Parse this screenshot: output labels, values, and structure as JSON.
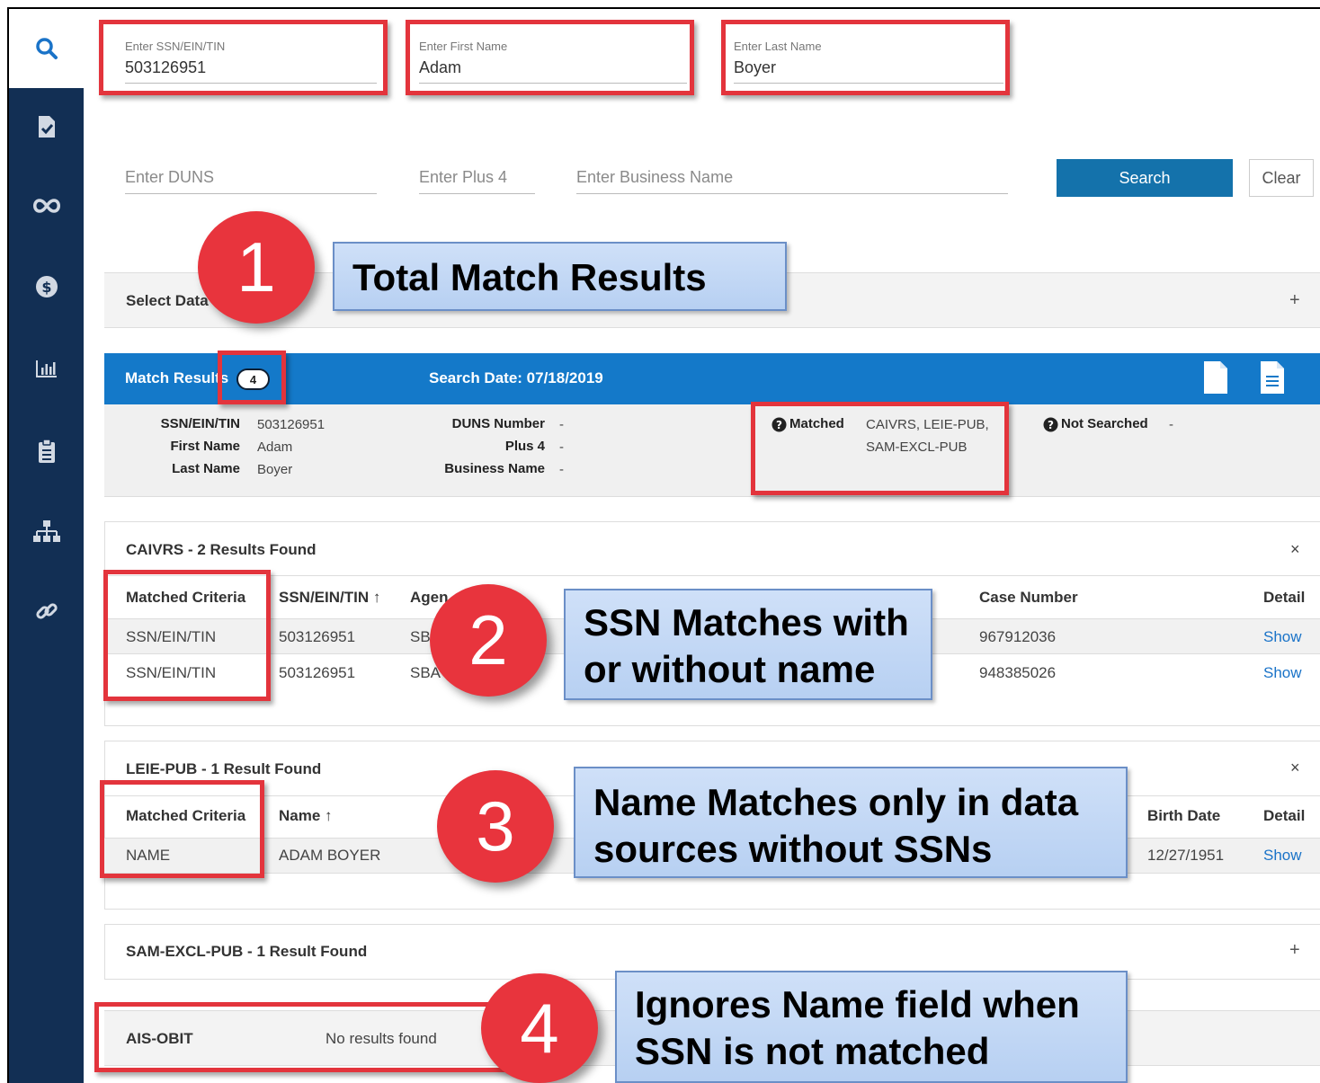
{
  "search": {
    "ssn_label": "Enter SSN/EIN/TIN",
    "ssn_value": "503126951",
    "first_label": "Enter First Name",
    "first_value": "Adam",
    "last_label": "Enter Last Name",
    "last_value": "Boyer",
    "duns_placeholder": "Enter DUNS",
    "plus4_placeholder": "Enter Plus 4",
    "business_placeholder": "Enter Business Name",
    "search_button": "Search",
    "clear_button": "Clear"
  },
  "select_data": {
    "label": "Select Data",
    "toggle": "+"
  },
  "match_results": {
    "label": "Match Results",
    "count": "4",
    "search_date": "Search Date: 07/18/2019"
  },
  "summary": {
    "ssn_k": "SSN/EIN/TIN",
    "ssn_v": "503126951",
    "first_k": "First Name",
    "first_v": "Adam",
    "last_k": "Last Name",
    "last_v": "Boyer",
    "duns_k": "DUNS Number",
    "duns_v": "-",
    "plus4_k": "Plus 4",
    "plus4_v": "-",
    "biz_k": "Business Name",
    "biz_v": "-",
    "matched_k": "Matched",
    "matched_v1": "CAIVRS, LEIE-PUB,",
    "matched_v2": "SAM-EXCL-PUB",
    "notsearched_k": "Not Searched",
    "notsearched_v": "-"
  },
  "caivrs": {
    "title": "CAIVRS - 2 Results Found",
    "close": "×",
    "headers": [
      "Matched Criteria",
      "SSN/EIN/TIN ↑",
      "Agen",
      "Case Number",
      "Detail"
    ],
    "rows": [
      {
        "criteria": "SSN/EIN/TIN",
        "ssn": "503126951",
        "agency": "SB",
        "case": "967912036",
        "detail": "Show"
      },
      {
        "criteria": "SSN/EIN/TIN",
        "ssn": "503126951",
        "agency": "SBA",
        "case": "948385026",
        "detail": "Show"
      }
    ]
  },
  "leie": {
    "title": "LEIE-PUB - 1 Result Found",
    "close": "×",
    "headers": [
      "Matched Criteria",
      "Name ↑",
      "Birth Date",
      "Detail"
    ],
    "rows": [
      {
        "criteria": "NAME",
        "name": "ADAM BOYER",
        "birth": "12/27/1951",
        "detail": "Show"
      }
    ]
  },
  "sam": {
    "title": "SAM-EXCL-PUB - 1 Result Found",
    "toggle": "+"
  },
  "ais": {
    "title": "AIS-OBIT",
    "status": "No results found"
  },
  "callouts": {
    "c1_num": "1",
    "c1_text": "Total Match Results",
    "c2_num": "2",
    "c2_line1": "SSN Matches with",
    "c2_line2": "or without name",
    "c3_num": "3",
    "c3_line1": "Name Matches only in data",
    "c3_line2": "sources without SSNs",
    "c4_num": "4",
    "c4_line1": "Ignores Name field when",
    "c4_line2": "SSN is not matched"
  },
  "icons": [
    "search-icon",
    "document-check-icon",
    "infinity-icon",
    "dollar-icon",
    "bar-chart-icon",
    "clipboard-icon",
    "sitemap-icon",
    "link-icon",
    "file-icon",
    "file-text-icon",
    "help-circle-icon"
  ],
  "colors": {
    "sidebar": "#122f54",
    "accent": "#1479c9",
    "button": "#1472ab",
    "highlight": "#e3343c",
    "callout_number": "#e8343d",
    "link": "#1a73c8"
  }
}
